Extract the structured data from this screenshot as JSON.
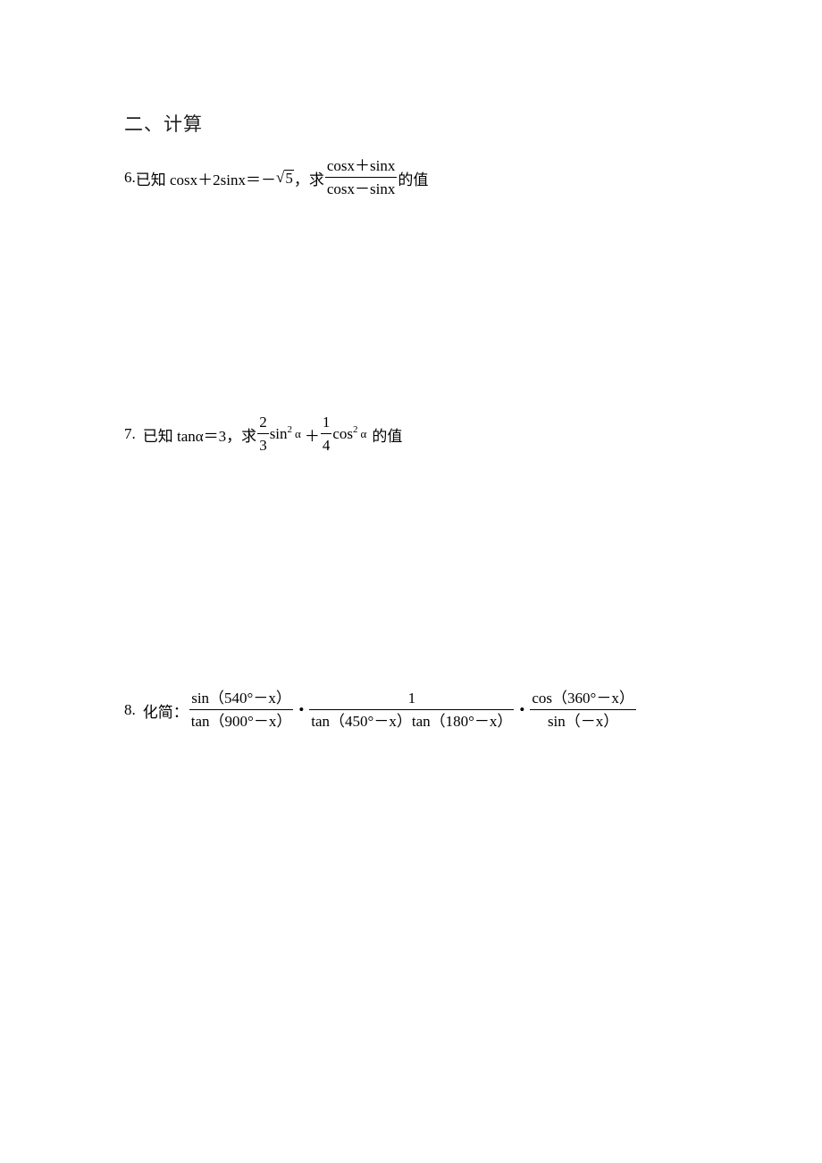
{
  "section": {
    "title": "二、计算"
  },
  "questions": [
    {
      "number": "6.",
      "prefix": "已知 cosx＋2sinx＝－",
      "sqrt_value": "5",
      "comma": "，求",
      "fraction": {
        "numerator": "cosx＋sinx",
        "denominator": "cosx－sinx"
      },
      "suffix": "的值"
    },
    {
      "number": "7.",
      "prefix": "已知 tanα＝3，求",
      "term1": {
        "numerator": "2",
        "denominator": "3",
        "func": "sin",
        "power": "2",
        "var": "α"
      },
      "plus": "＋",
      "term2": {
        "numerator": "1",
        "denominator": "4",
        "func": "cos",
        "power": "2",
        "var": "α"
      },
      "suffix": "的值"
    },
    {
      "number": "8.",
      "prefix": "化简：",
      "fractions": [
        {
          "numerator": "sin（540°－x）",
          "denominator": "tan（900°－x）"
        },
        {
          "numerator": "1",
          "denominator": "tan（450°－x）tan（180°－x）"
        },
        {
          "numerator": "cos（360°－x）",
          "denominator": "sin（－x）"
        }
      ],
      "dot": "•"
    }
  ]
}
